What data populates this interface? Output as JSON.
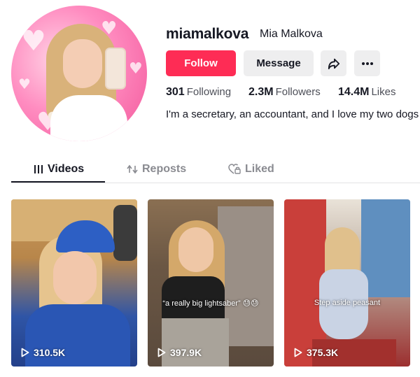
{
  "profile": {
    "username": "miamalkova",
    "nickname": "Mia Malkova",
    "bio": "I'm a secretary, an accountant, and I love my two dogs"
  },
  "actions": {
    "follow_label": "Follow",
    "message_label": "Message",
    "share_icon": "share-icon",
    "more_icon": "more-icon"
  },
  "stats": [
    {
      "value": "301",
      "label": "Following"
    },
    {
      "value": "2.3M",
      "label": "Followers"
    },
    {
      "value": "14.4M",
      "label": "Likes"
    }
  ],
  "tabs": [
    {
      "label": "Videos",
      "icon": "grid-icon",
      "active": true
    },
    {
      "label": "Reposts",
      "icon": "repost-icon",
      "active": false
    },
    {
      "label": "Liked",
      "icon": "heart-lock-icon",
      "active": false
    }
  ],
  "videos": [
    {
      "views": "310.5K",
      "caption": ""
    },
    {
      "views": "397.9K",
      "caption": "“a really big lightsaber” 😓😓"
    },
    {
      "views": "375.3K",
      "caption": "Step aside peasant"
    }
  ],
  "colors": {
    "accent": "#fe2c55",
    "text": "#161823",
    "muted": "#8a8b91"
  }
}
